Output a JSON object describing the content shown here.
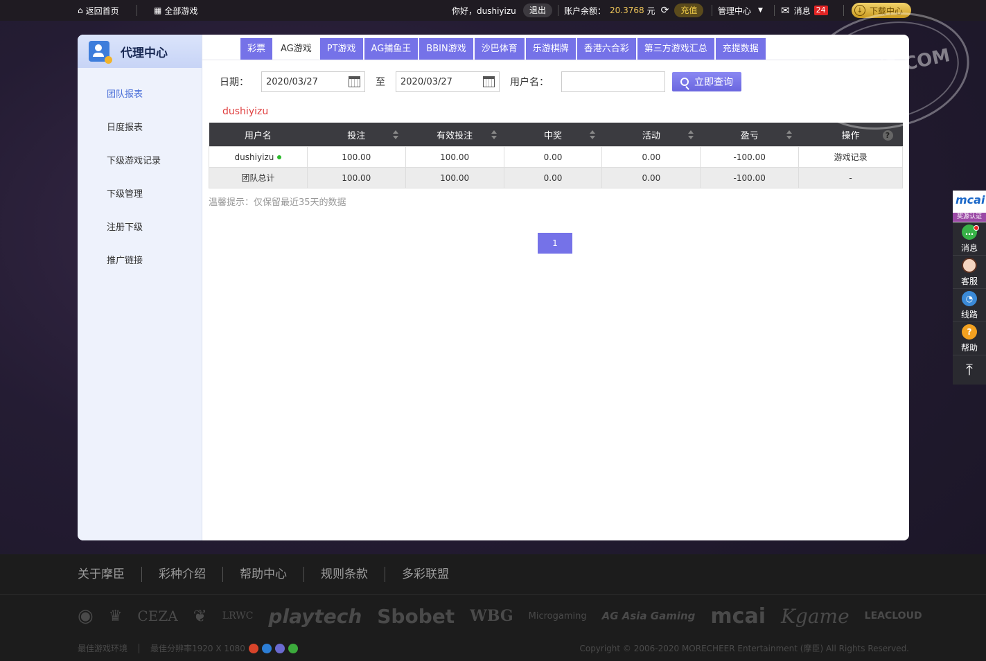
{
  "topbar": {
    "home": "返回首页",
    "all_games": "全部游戏",
    "greeting": "你好，dushiyizu",
    "logout": "退出",
    "balance_label": "账户余额：",
    "balance_value": "20.3768",
    "balance_unit": "元",
    "recharge": "充值",
    "manage": "管理中心",
    "messages": "消息",
    "message_count": "24",
    "download": "下载中心"
  },
  "sidebar": {
    "title": "代理中心",
    "items": [
      {
        "label": "团队报表",
        "active": true
      },
      {
        "label": "日度报表"
      },
      {
        "label": "下级游戏记录"
      },
      {
        "label": "下级管理"
      },
      {
        "label": "注册下级"
      },
      {
        "label": "推广链接"
      }
    ]
  },
  "tabs": [
    "彩票",
    "AG游戏",
    "PT游戏",
    "AG捕鱼王",
    "BBIN游戏",
    "沙巴体育",
    "乐游棋牌",
    "香港六合彩",
    "第三方游戏汇总",
    "充提数据"
  ],
  "active_tab": "AG游戏",
  "filters": {
    "date_label": "日期：",
    "date_from": "2020/03/27",
    "to_label": "至",
    "date_to": "2020/03/27",
    "user_label": "用户名：",
    "user_value": "",
    "query_button": "立即查询"
  },
  "current_user": "dushiyizu",
  "table": {
    "headers": [
      "用户名",
      "投注",
      "有效投注",
      "中奖",
      "活动",
      "盈亏",
      "操作"
    ],
    "rows": [
      [
        "dushiyizu",
        "100.00",
        "100.00",
        "0.00",
        "0.00",
        "-100.00",
        "游戏记录"
      ],
      [
        "团队总计",
        "100.00",
        "100.00",
        "0.00",
        "0.00",
        "-100.00",
        "-"
      ]
    ]
  },
  "hint": "温馨提示：仅保留最近35天的数据",
  "pagination": {
    "current": "1"
  },
  "right_bar": {
    "mcai_logo": "mcai",
    "mcai_sub": "奖源认证",
    "items": [
      "消息",
      "客服",
      "线路",
      "帮助"
    ]
  },
  "watermark": "性吧论坛.COM",
  "footer": {
    "links": [
      "关于摩臣",
      "彩种介绍",
      "帮助中心",
      "规则条款",
      "多彩联盟"
    ],
    "partner_logos": [
      "CEZA",
      "LRWC",
      "playtech",
      "Sbobet",
      "WBG",
      "Microgaming",
      "AG Asia Gaming",
      "mcai",
      "Kgame",
      "LEACLOUD"
    ],
    "best_env": "最佳游戏环境",
    "resolution": "最佳分辨率1920 X 1080",
    "copyright": "Copyright © 2006-2020 MORECHEER Entertainment (摩臣) All Rights Reserved."
  }
}
